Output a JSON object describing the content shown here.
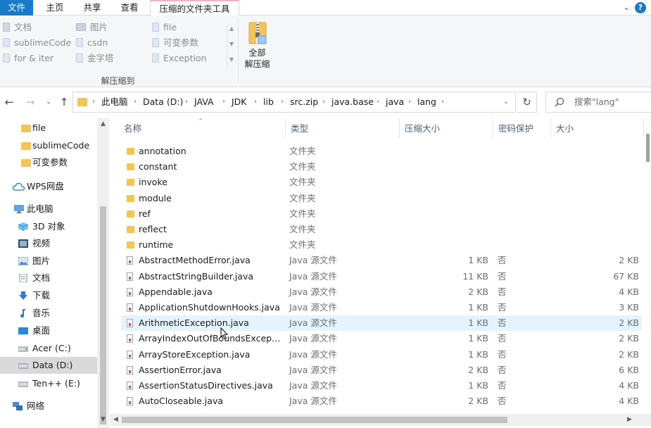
{
  "ribbon": {
    "tabs": {
      "file": "文件",
      "home": "主页",
      "share": "共享",
      "view": "查看",
      "tools": "压缩的文件夹工具"
    },
    "gallery": {
      "items": [
        {
          "label": "文档",
          "icon": "document-icon"
        },
        {
          "label": "图片",
          "icon": "picture-icon"
        },
        {
          "label": "file",
          "icon": "folder-icon"
        },
        {
          "label": "sublimeCode",
          "icon": "folder-icon"
        },
        {
          "label": "csdn",
          "icon": "folder-icon"
        },
        {
          "label": "可变参数",
          "icon": "folder-icon"
        },
        {
          "label": "for & iter",
          "icon": "folder-icon"
        },
        {
          "label": "金字塔",
          "icon": "folder-icon"
        },
        {
          "label": "Exception",
          "icon": "folder-icon"
        }
      ]
    },
    "extract_all_label": "全部\n解压缩",
    "group_label": "解压缩到"
  },
  "address": {
    "breadcrumbs": [
      "此电脑",
      "Data (D:)",
      "JAVA",
      "JDK",
      "lib",
      "src.zip",
      "java.base",
      "java",
      "lang"
    ]
  },
  "search": {
    "placeholder": "搜索\"lang\""
  },
  "navpane": {
    "items": [
      {
        "label": "file",
        "icon": "folder-icon"
      },
      {
        "label": "sublimeCode",
        "icon": "folder-icon"
      },
      {
        "label": "可变参数",
        "icon": "folder-icon"
      },
      {
        "label": "WPS网盘",
        "icon": "cloud-icon"
      },
      {
        "label": "此电脑",
        "icon": "computer-icon"
      },
      {
        "label": "3D 对象",
        "icon": "cube-icon"
      },
      {
        "label": "视频",
        "icon": "video-icon"
      },
      {
        "label": "图片",
        "icon": "picture-icon"
      },
      {
        "label": "文档",
        "icon": "document-icon"
      },
      {
        "label": "下载",
        "icon": "download-icon"
      },
      {
        "label": "音乐",
        "icon": "music-icon"
      },
      {
        "label": "桌面",
        "icon": "desktop-icon"
      },
      {
        "label": "Acer (C:)",
        "icon": "drive-icon"
      },
      {
        "label": "Data (D:)",
        "icon": "drive-icon"
      },
      {
        "label": "Ten++ (E:)",
        "icon": "drive-icon"
      },
      {
        "label": "网络",
        "icon": "network-icon"
      }
    ],
    "selected": "Data (D:)"
  },
  "filelist": {
    "columns": {
      "name": "名称",
      "type": "类型",
      "compressed": "压缩大小",
      "password": "密码保护",
      "size": "大小"
    },
    "rows": [
      {
        "name": "annotation",
        "type": "文件夹",
        "compressed": "",
        "password": "",
        "size": "",
        "kind": "folder"
      },
      {
        "name": "constant",
        "type": "文件夹",
        "compressed": "",
        "password": "",
        "size": "",
        "kind": "folder"
      },
      {
        "name": "invoke",
        "type": "文件夹",
        "compressed": "",
        "password": "",
        "size": "",
        "kind": "folder"
      },
      {
        "name": "module",
        "type": "文件夹",
        "compressed": "",
        "password": "",
        "size": "",
        "kind": "folder"
      },
      {
        "name": "ref",
        "type": "文件夹",
        "compressed": "",
        "password": "",
        "size": "",
        "kind": "folder"
      },
      {
        "name": "reflect",
        "type": "文件夹",
        "compressed": "",
        "password": "",
        "size": "",
        "kind": "folder"
      },
      {
        "name": "runtime",
        "type": "文件夹",
        "compressed": "",
        "password": "",
        "size": "",
        "kind": "folder"
      },
      {
        "name": "AbstractMethodError.java",
        "type": "Java 源文件",
        "compressed": "1 KB",
        "password": "否",
        "size": "2 KB",
        "kind": "java"
      },
      {
        "name": "AbstractStringBuilder.java",
        "type": "Java 源文件",
        "compressed": "11 KB",
        "password": "否",
        "size": "67 KB",
        "kind": "java"
      },
      {
        "name": "Appendable.java",
        "type": "Java 源文件",
        "compressed": "2 KB",
        "password": "否",
        "size": "4 KB",
        "kind": "java"
      },
      {
        "name": "ApplicationShutdownHooks.java",
        "type": "Java 源文件",
        "compressed": "1 KB",
        "password": "否",
        "size": "3 KB",
        "kind": "java"
      },
      {
        "name": "ArithmeticException.java",
        "type": "Java 源文件",
        "compressed": "1 KB",
        "password": "否",
        "size": "2 KB",
        "kind": "java"
      },
      {
        "name": "ArrayIndexOutOfBoundsExcepti...",
        "type": "Java 源文件",
        "compressed": "1 KB",
        "password": "否",
        "size": "2 KB",
        "kind": "java"
      },
      {
        "name": "ArrayStoreException.java",
        "type": "Java 源文件",
        "compressed": "1 KB",
        "password": "否",
        "size": "2 KB",
        "kind": "java"
      },
      {
        "name": "AssertionError.java",
        "type": "Java 源文件",
        "compressed": "2 KB",
        "password": "否",
        "size": "6 KB",
        "kind": "java"
      },
      {
        "name": "AssertionStatusDirectives.java",
        "type": "Java 源文件",
        "compressed": "1 KB",
        "password": "否",
        "size": "4 KB",
        "kind": "java"
      },
      {
        "name": "AutoCloseable.java",
        "type": "Java 源文件",
        "compressed": "2 KB",
        "password": "否",
        "size": "4 KB",
        "kind": "java"
      }
    ],
    "hover_row": "ArithmeticException.java"
  },
  "colors": {
    "accent": "#1979ca",
    "hover": "#e5f3ff",
    "folder": "#f2c55b",
    "tools_tab_top": "#f7b0c6"
  }
}
